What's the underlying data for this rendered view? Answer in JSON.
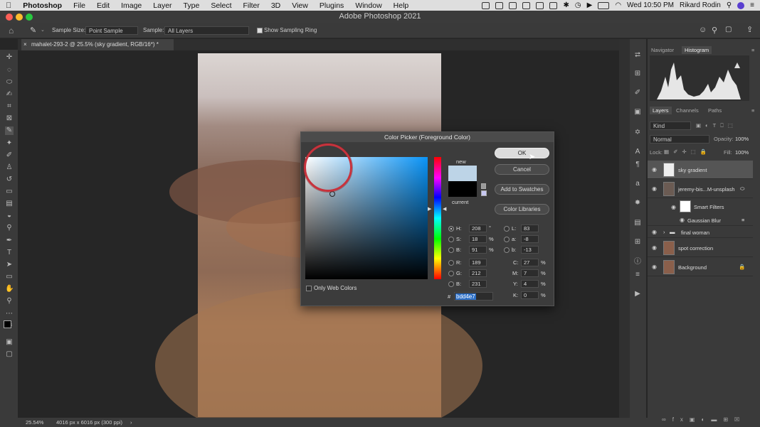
{
  "menubar": {
    "app": "Photoshop",
    "items": [
      "File",
      "Edit",
      "Image",
      "Layer",
      "Type",
      "Select",
      "Filter",
      "3D",
      "View",
      "Plugins",
      "Window",
      "Help"
    ],
    "clock": "Wed 10:50 PM",
    "user": "Rikard Rodin"
  },
  "window": {
    "title": "Adobe Photoshop 2021"
  },
  "options": {
    "sample_size_label": "Sample Size:",
    "sample_size_value": "Point Sample",
    "sample_label": "Sample:",
    "sample_value": "All Layers",
    "show_ring_label": "Show Sampling Ring"
  },
  "document": {
    "tab_title": "mahalet-293-2 @ 25.5% (sky gradient, RGB/16*) *"
  },
  "status": {
    "zoom": "25.54%",
    "info": "4016 px x 6016 px (300 ppi)",
    "arrow": "›"
  },
  "panels": {
    "top_tabs": [
      "Navigator",
      "Histogram"
    ],
    "layer_tabs": [
      "Layers",
      "Channels",
      "Paths"
    ],
    "kind": "Kind",
    "blend_mode": "Normal",
    "opacity_label": "Opacity:",
    "opacity_value": "100%",
    "lock_label": "Lock:",
    "fill_label": "Fill:",
    "fill_value": "100%",
    "layers": [
      {
        "name": "sky gradient"
      },
      {
        "name": "jeremy-bis...M-unsplash"
      },
      {
        "name": "Smart Filters"
      },
      {
        "name": "Gaussian Blur"
      },
      {
        "name": "final woman"
      },
      {
        "name": "spot correction"
      },
      {
        "name": "Background"
      }
    ]
  },
  "dialog": {
    "title": "Color Picker (Foreground Color)",
    "new_label": "new",
    "current_label": "current",
    "ok": "OK",
    "cancel": "Cancel",
    "add_swatches": "Add to Swatches",
    "color_libraries": "Color Libraries",
    "only_web": "Only Web Colors",
    "new_color": "#bdd4e7",
    "current_color": "#000000",
    "fields": {
      "H": "208",
      "S": "18",
      "B": "91",
      "R": "189",
      "G": "212",
      "Bb": "231",
      "L": "83",
      "a": "-8",
      "b": "-13",
      "C": "27",
      "M": "7",
      "Y": "4",
      "K": "0"
    },
    "units": {
      "deg": "°",
      "pct": "%"
    },
    "hex_hash": "#",
    "hex": "bdd4e7"
  }
}
